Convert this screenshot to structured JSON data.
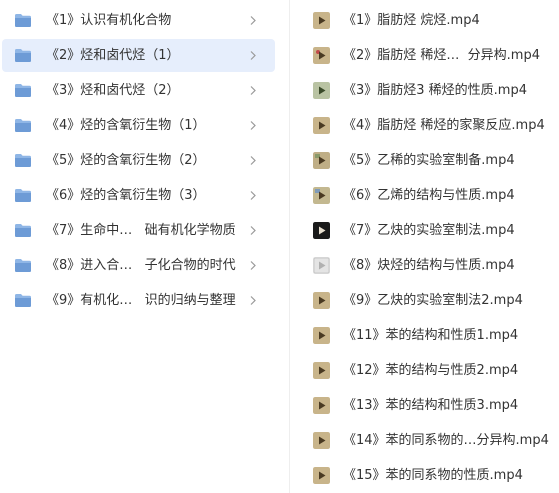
{
  "accent_color": "#e6eefc",
  "folder_icon_color": "#8fb6e6",
  "folders": [
    {
      "label": "《1》认识有机化合物",
      "icon": "folder-icon",
      "selected": false
    },
    {
      "label": "《2》烃和卤代烃（1）",
      "icon": "folder-icon",
      "selected": true
    },
    {
      "label": "《3》烃和卤代烃（2）",
      "icon": "folder-icon",
      "selected": false
    },
    {
      "label": "《4》烃的含氧衍生物（1）",
      "icon": "folder-icon",
      "selected": false
    },
    {
      "label": "《5》烃的含氧衍生物（2）",
      "icon": "folder-icon",
      "selected": false
    },
    {
      "label": "《6》烃的含氧衍生物（3）",
      "icon": "folder-icon",
      "selected": false
    },
    {
      "label": "《7》生命中…   础有机化学物质",
      "icon": "folder-icon",
      "selected": false
    },
    {
      "label": "《8》进入合…   子化合物的时代",
      "icon": "folder-icon",
      "selected": false
    },
    {
      "label": "《9》有机化…   识的归纳与整理",
      "icon": "folder-icon",
      "selected": false
    }
  ],
  "videos": [
    {
      "label": "《1》脂肪烃 烷烃.mp4",
      "thumb": "video-thumb-icon"
    },
    {
      "label": "《2》脂肪烃 稀烃…  分异构.mp4",
      "thumb": "video-thumb-icon"
    },
    {
      "label": "《3》脂肪烃3 稀烃的性质.mp4",
      "thumb": "video-thumb-icon"
    },
    {
      "label": "《4》脂肪烃 稀烃的家聚反应.mp4",
      "thumb": "video-thumb-icon"
    },
    {
      "label": "《5》乙稀的实验室制备.mp4",
      "thumb": "video-thumb-icon"
    },
    {
      "label": "《6》乙烯的结构与性质.mp4",
      "thumb": "video-thumb-icon"
    },
    {
      "label": "《7》乙炔的实验室制法.mp4",
      "thumb": "video-thumb-icon"
    },
    {
      "label": "《8》炔烃的结构与性质.mp4",
      "thumb": "video-thumb-icon"
    },
    {
      "label": "《9》乙炔的实验室制法2.mp4",
      "thumb": "video-thumb-icon"
    },
    {
      "label": "《11》苯的结构和性质1.mp4",
      "thumb": "video-thumb-icon"
    },
    {
      "label": "《12》苯的结构与性质2.mp4",
      "thumb": "video-thumb-icon"
    },
    {
      "label": "《13》苯的结构和性质3.mp4",
      "thumb": "video-thumb-icon"
    },
    {
      "label": "《14》苯的同系物的…分异构.mp4",
      "thumb": "video-thumb-icon"
    },
    {
      "label": "《15》苯的同系物的性质.mp4",
      "thumb": "video-thumb-icon"
    }
  ]
}
